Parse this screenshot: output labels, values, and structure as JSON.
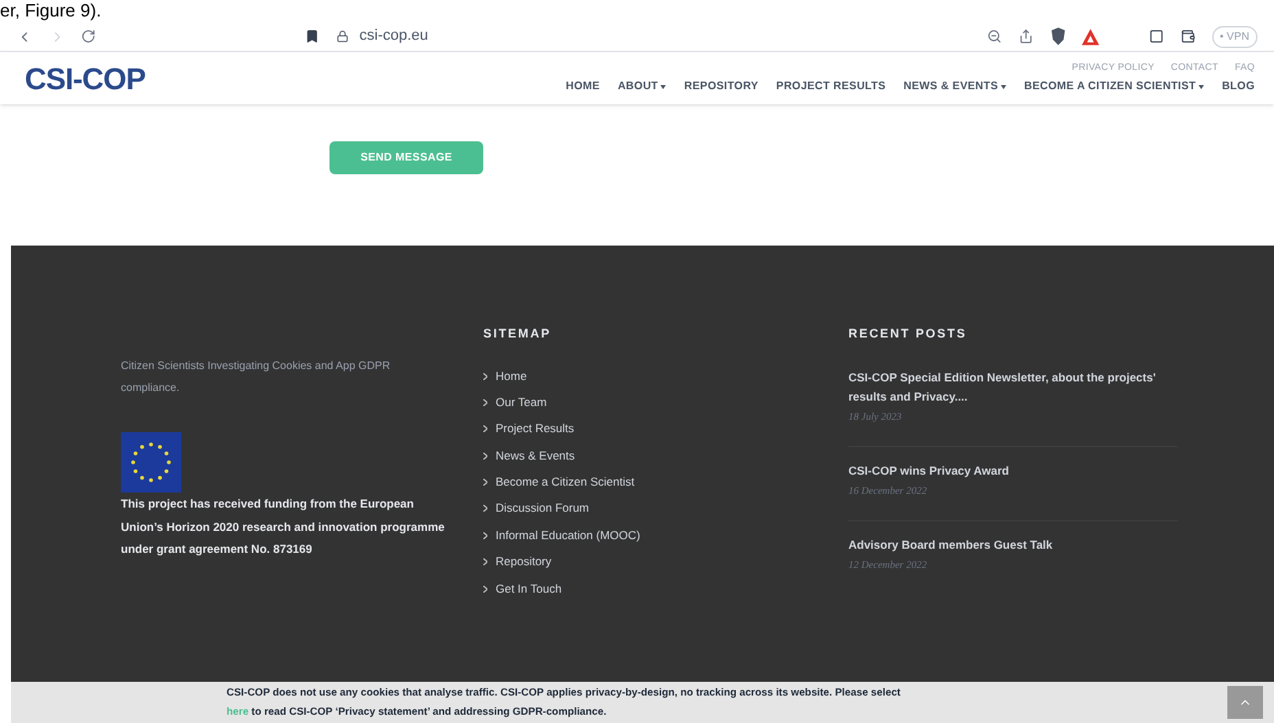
{
  "caption": "er, Figure 9).",
  "browser": {
    "url": "csi-cop.eu",
    "vpn": "• VPN"
  },
  "site": {
    "logo": "CSI-COP",
    "top_links": [
      "PRIVACY POLICY",
      "CONTACT",
      "FAQ"
    ],
    "nav": [
      {
        "label": "HOME",
        "dropdown": false
      },
      {
        "label": "ABOUT",
        "dropdown": true
      },
      {
        "label": "REPOSITORY",
        "dropdown": false
      },
      {
        "label": "PROJECT RESULTS",
        "dropdown": false
      },
      {
        "label": "NEWS & EVENTS",
        "dropdown": true
      },
      {
        "label": "BECOME A CITIZEN SCIENTIST",
        "dropdown": true
      },
      {
        "label": "BLOG",
        "dropdown": false
      }
    ]
  },
  "send_button": "SEND MESSAGE",
  "footer": {
    "tagline": "Citizen Scientists Investigating Cookies and App GDPR compliance.",
    "funding": "This project has received funding from the European Union’s Horizon 2020 research and innovation programme under grant agreement No. 873169",
    "sitemap": {
      "title": "SITEMAP",
      "items": [
        "Home",
        "Our Team",
        "Project Results",
        "News & Events",
        "Become a Citizen Scientist",
        "Discussion Forum",
        "Informal Education (MOOC)",
        "Repository",
        "Get In Touch"
      ]
    },
    "recent_posts": {
      "title": "RECENT POSTS",
      "items": [
        {
          "title": "CSI-COP Special Edition Newsletter, about the projects' results and Privacy....",
          "date": "18 July 2023"
        },
        {
          "title": "CSI-COP wins Privacy Award",
          "date": "16 December 2022"
        },
        {
          "title": "Advisory Board members Guest Talk",
          "date": "12 December 2022"
        }
      ]
    }
  },
  "cookie_bar": {
    "text_before": "CSI-COP does not use any cookies that analyse traffic. CSI-COP applies privacy-by-design, no tracking across its website. Please select",
    "link": "here",
    "text_after": "to read CSI-COP ‘Privacy statement’ and addressing GDPR-compliance."
  }
}
